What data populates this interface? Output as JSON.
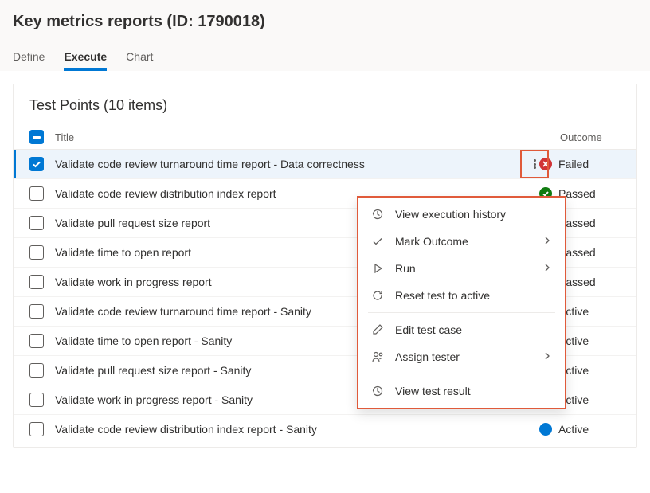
{
  "header": {
    "title": "Key metrics reports (ID: 1790018)",
    "tabs": {
      "define": "Define",
      "execute": "Execute",
      "chart": "Chart"
    }
  },
  "card": {
    "title": "Test Points (10 items)",
    "columns": {
      "title": "Title",
      "outcome": "Outcome"
    }
  },
  "rows": [
    {
      "title": "Validate code review turnaround time report - Data correctness",
      "outcome": "Failed",
      "status": "failed",
      "selected": true,
      "kebab": true
    },
    {
      "title": "Validate code review distribution index report",
      "outcome": "Passed",
      "status": "passed"
    },
    {
      "title": "Validate pull request size report",
      "outcome": "Passed",
      "status": "passed"
    },
    {
      "title": "Validate time to open report",
      "outcome": "Passed",
      "status": "passed"
    },
    {
      "title": "Validate work in progress report",
      "outcome": "Passed",
      "status": "passed"
    },
    {
      "title": "Validate code review turnaround time report - Sanity",
      "outcome": "Active",
      "status": "active"
    },
    {
      "title": "Validate time to open report - Sanity",
      "outcome": "Active",
      "status": "active"
    },
    {
      "title": "Validate pull request size report - Sanity",
      "outcome": "Active",
      "status": "active"
    },
    {
      "title": "Validate work in progress report - Sanity",
      "outcome": "Active",
      "status": "active"
    },
    {
      "title": "Validate code review distribution index report - Sanity",
      "outcome": "Active",
      "status": "active"
    }
  ],
  "menu": {
    "view_history": "View execution history",
    "mark_outcome": "Mark Outcome",
    "run": "Run",
    "reset": "Reset test to active",
    "edit": "Edit test case",
    "assign": "Assign tester",
    "view_result": "View test result"
  }
}
